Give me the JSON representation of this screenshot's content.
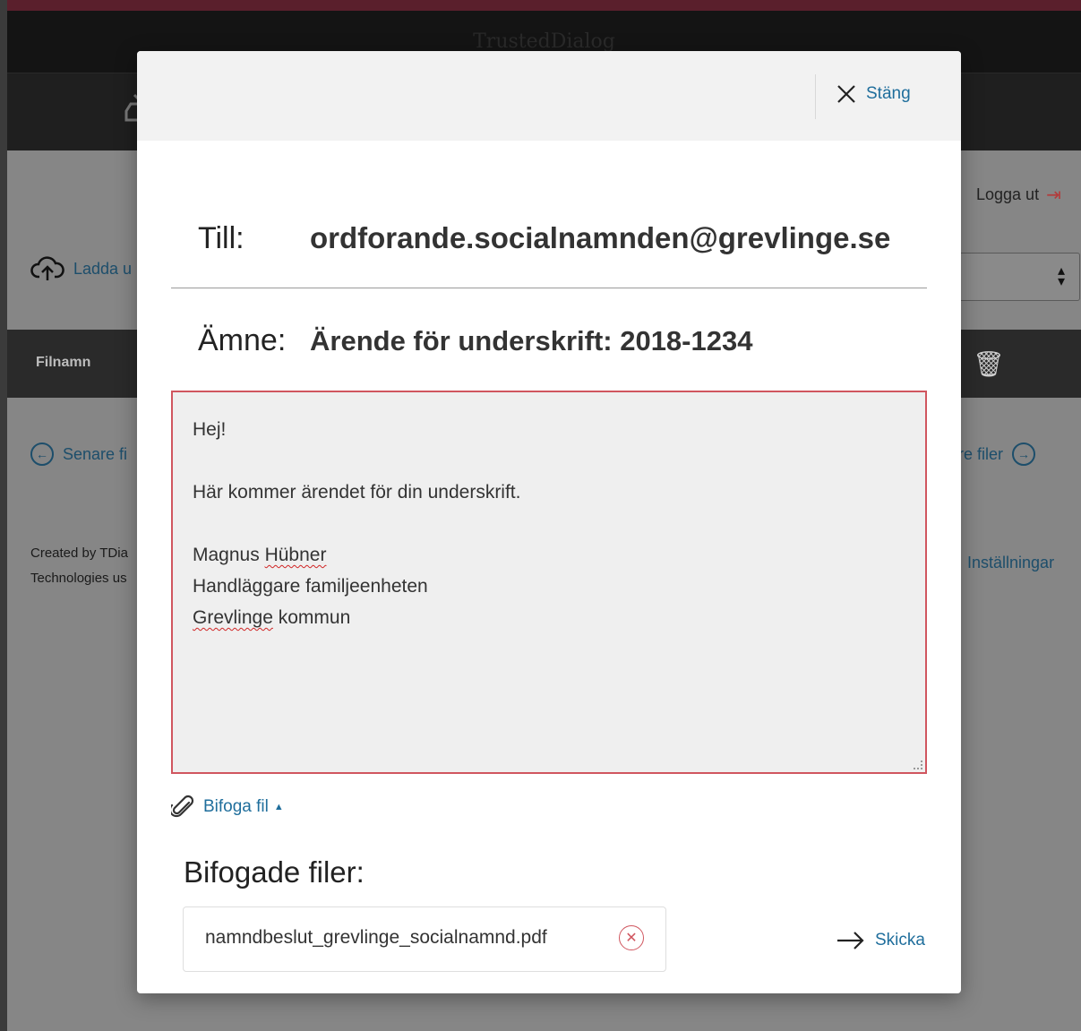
{
  "background": {
    "app_title": "TrustedDialog",
    "logout_label": "Logga ut",
    "upload_label": "Ladda u",
    "table_header_filename": "Filnamn",
    "pager_prev": "Senare fi",
    "pager_next": "gare filer",
    "footer_line1": "Created by TDia",
    "footer_line2": "Technologies us",
    "settings_label": "Inställningar"
  },
  "modal": {
    "close_label": "Stäng",
    "to_label": "Till:",
    "to_value": "ordforande.socialnamnden@grevlinge.se",
    "subject_label": "Ämne:",
    "subject_value": "Ärende för underskrift: 2018-1234",
    "message": {
      "greeting": "Hej!",
      "body": "Här kommer ärendet för din underskrift.",
      "sig_name_first": "Magnus",
      "sig_name_last": "Hübner",
      "sig_title": "Handläggare familjeenheten",
      "sig_org_first": "Grevlinge",
      "sig_org_last": "kommun"
    },
    "attach_label": "Bifoga fil",
    "attached_title": "Bifogade filer:",
    "attached_files": [
      {
        "name": "namndbeslut_grevlinge_socialnamnd.pdf"
      }
    ],
    "send_label": "Skicka"
  },
  "colors": {
    "accent_link": "#1f6e9c",
    "error_border": "#d0565f"
  }
}
